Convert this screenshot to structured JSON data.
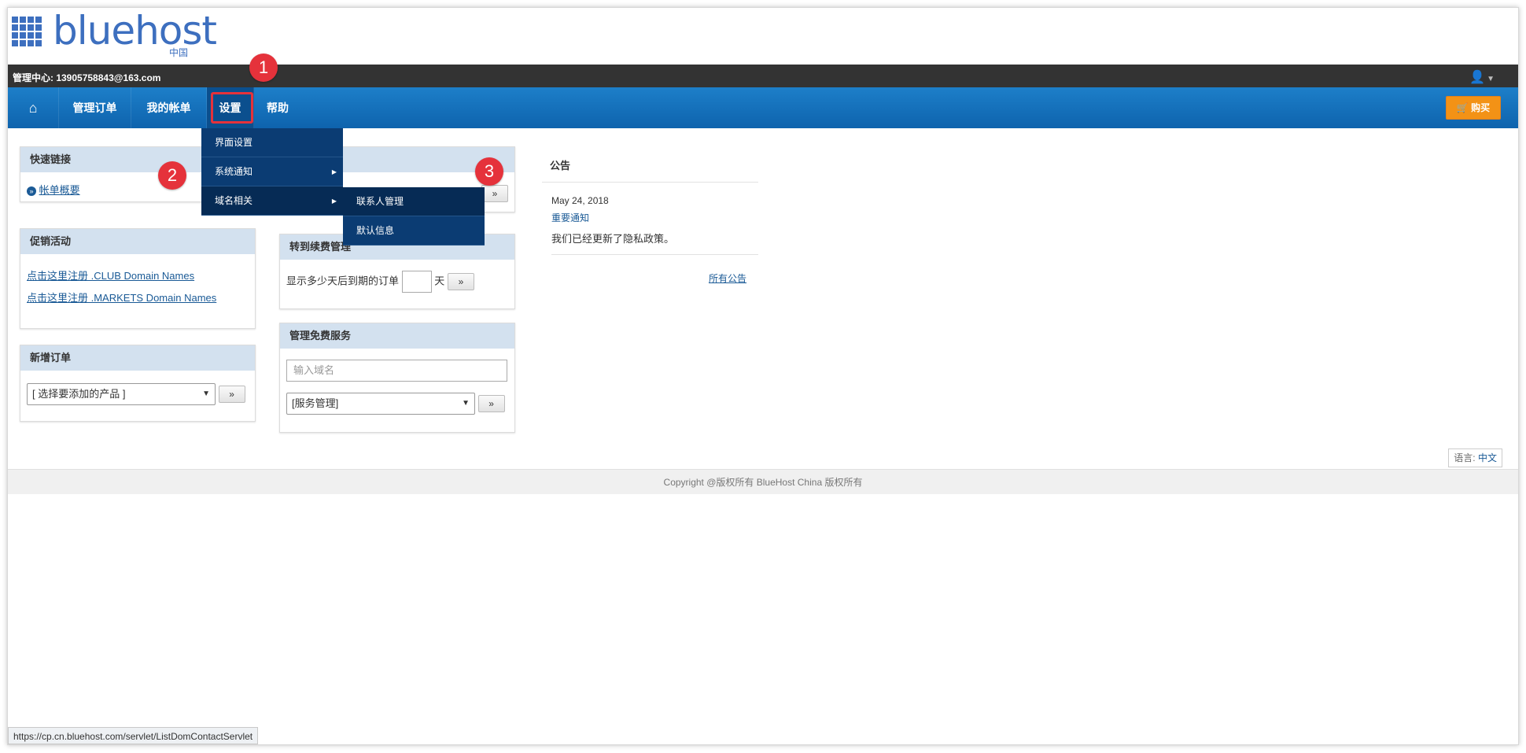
{
  "logo": {
    "text": "bluehost",
    "sub": "中国"
  },
  "admin_bar": {
    "label": "管理中心: 13905758843@163.com"
  },
  "nav": {
    "home_icon": "home-icon",
    "items": [
      "管理订单",
      "我的帐单",
      "设置",
      "帮助"
    ],
    "buy": "购买"
  },
  "dropdown": {
    "items": [
      "界面设置",
      "系统通知",
      "域名相关"
    ]
  },
  "subdropdown": {
    "items": [
      "联系人管理",
      "默认信息"
    ]
  },
  "badges": [
    "1",
    "2",
    "3"
  ],
  "quick_links": {
    "title": "快速链接",
    "link": "帐单概要"
  },
  "promo": {
    "title": "促销活动",
    "links": [
      "点击这里注册 .CLUB Domain Names",
      "点击这里注册 .MARKETS Domain Names"
    ]
  },
  "new_order": {
    "title": "新增订单",
    "select": "[ 选择要添加的产品 ]",
    "go": "»"
  },
  "renewal": {
    "title": "转到续费管理",
    "label": "显示多少天后到期的订单",
    "unit": "天",
    "go": "»"
  },
  "free_service": {
    "title": "管理免费服务",
    "placeholder": "输入域名",
    "select": "[服务管理]",
    "go": "»"
  },
  "hidden_panel_go": "»",
  "announcements": {
    "title": "公告",
    "date": "May 24, 2018",
    "subject": "重要通知",
    "text": "我们已经更新了隐私政策。",
    "all": "所有公告"
  },
  "language": {
    "label": "语言:",
    "value": "中文"
  },
  "footer": "Copyright @版权所有 BlueHost China 版权所有",
  "status_url": "https://cp.cn.bluehost.com/servlet/ListDomContactServlet",
  "colors": {
    "nav": "#1a7ac4",
    "accent": "#e5323b",
    "buy": "#f39216",
    "menu": "#0b3c73"
  }
}
